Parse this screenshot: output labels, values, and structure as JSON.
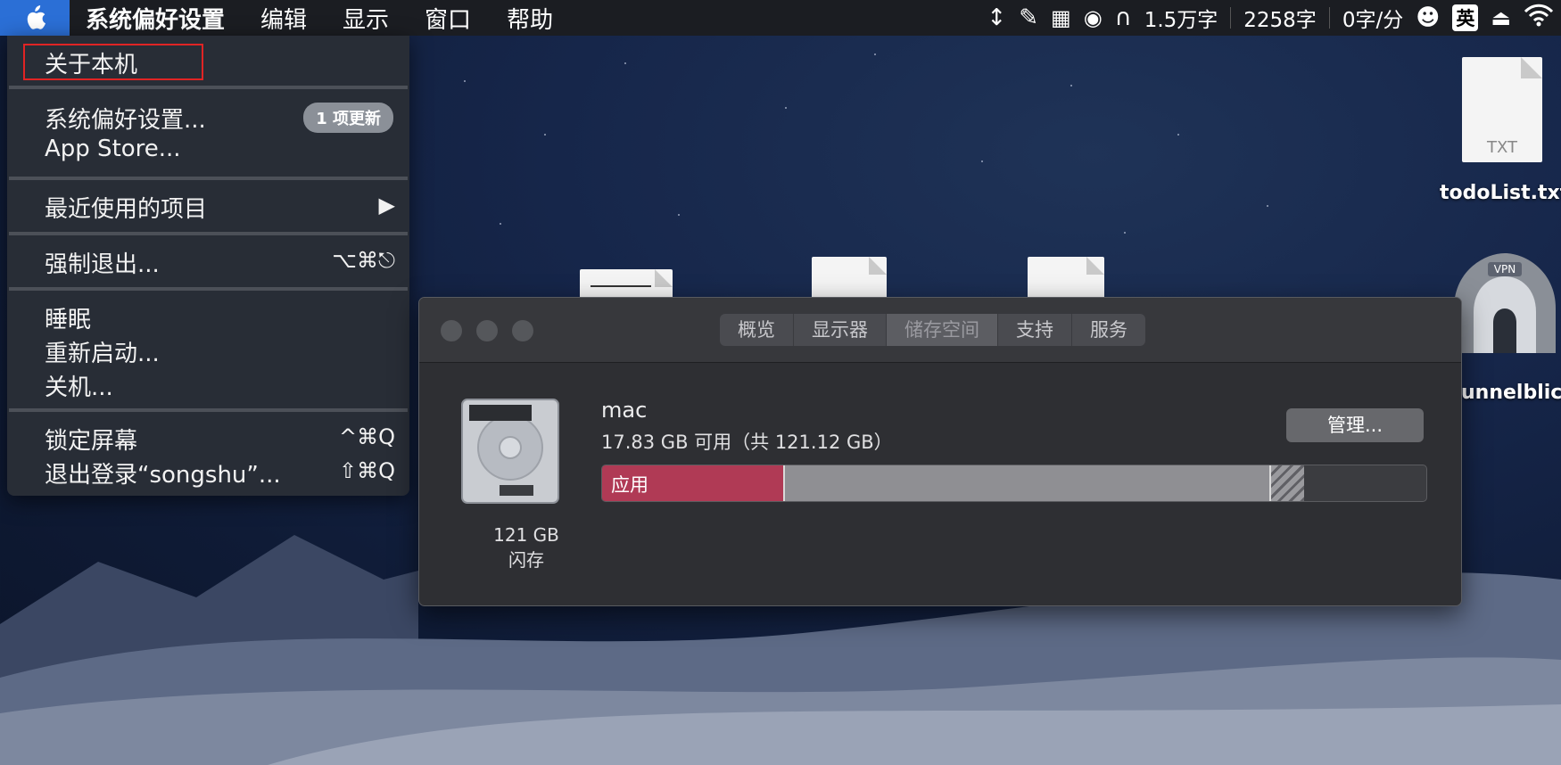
{
  "menubar": {
    "app_name": "系统偏好设置",
    "menus": [
      "编辑",
      "显示",
      "窗口",
      "帮助"
    ],
    "status": {
      "words_total": "1.5万字",
      "words_today": "2258字",
      "rate": "0字/分",
      "input_method": "英"
    }
  },
  "apple_menu": {
    "about": "关于本机",
    "system_prefs": "系统偏好设置...",
    "update_badge": "1 项更新",
    "app_store": "App Store...",
    "recent_items": "最近使用的项目",
    "recent_arrow": "▶",
    "force_quit": "强制退出...",
    "force_quit_shortcut": "⌥⌘⎋",
    "sleep": "睡眠",
    "restart": "重新启动...",
    "shutdown": "关机...",
    "lock_screen": "锁定屏幕",
    "lock_shortcut": "^⌘Q",
    "logout": "退出登录“songshu”...",
    "logout_shortcut": "⇧⌘Q"
  },
  "desktop": {
    "todo_file_type": "TXT",
    "todo_file_name": "todoList.txt",
    "tunnel_label": "unnelblick",
    "vpn_label": "VPN"
  },
  "window": {
    "tabs": [
      "概览",
      "显示器",
      "储存空间",
      "支持",
      "服务"
    ],
    "active_tab": "储存空间",
    "volume_name": "mac",
    "volume_info": "17.83 GB 可用（共 121.12 GB）",
    "manage_button": "管理...",
    "disk_size": "121 GB",
    "disk_type": "闪存",
    "storage": {
      "app_label": "应用",
      "app_fraction": 0.22,
      "other_fraction": 0.59,
      "purgeable_fraction": 0.04
    }
  }
}
